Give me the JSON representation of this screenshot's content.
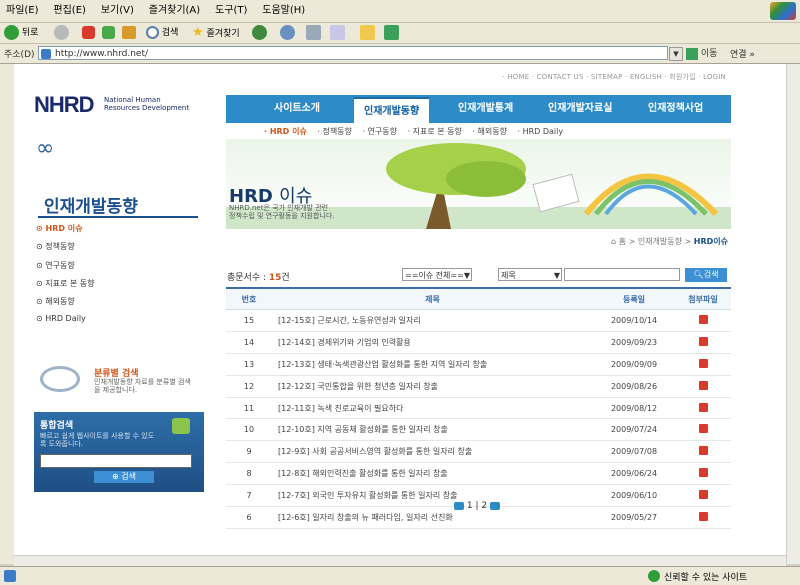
{
  "browser": {
    "menu": [
      "파일(E)",
      "편집(E)",
      "보기(V)",
      "즐겨찾기(A)",
      "도구(T)",
      "도움말(H)"
    ],
    "toolbar": {
      "back": "뒤로",
      "search": "검색",
      "favorites": "즐겨찾기"
    },
    "address_label": "주소(D)",
    "url": "http://www.nhrd.net/",
    "go_label": "이동",
    "links_label": "연결 »",
    "status_text": "신뢰할 수 있는 사이트"
  },
  "site": {
    "util_links": "· HOME · CONTACT US · SITEMAP · ENGLISH · 회원가입 · LOGIN",
    "logo": "NHRD",
    "logo_sub_1": "National Human",
    "logo_sub_2": "Resources Development",
    "gnb": [
      "사이트소개",
      "인재개발동향",
      "인재개발통계",
      "인재개발자료실",
      "인재정책사업"
    ],
    "subnav": [
      "· HRD 이슈",
      "· 정책동향",
      "· 연구동향",
      "· 지표로 본 동향",
      "· 해외동향",
      "· HRD Daily"
    ],
    "side_title": "인재개발동향",
    "side_nav": [
      "HRD 이슈",
      "정책동향",
      "연구동향",
      "지표로 본 동향",
      "해외동향",
      "HRD Daily"
    ],
    "cat_search_title": "분류별 검색",
    "cat_search_desc": "인재개발동향 자료를 분류별 검색을 제공합니다.",
    "total_search_title": "통합검색",
    "total_search_desc": "빠르고 쉽게 웹사이트를 사용할 수 있도록 도와줍니다.",
    "total_search_button": "검색",
    "banner_title_a": "HRD ",
    "banner_title_b": "이슈",
    "banner_desc_1": "NHRD.net은 국가 인재개발 관련",
    "banner_desc_2": "정책수립 및 연구활동을 지원합니다.",
    "crumb": "홈 > 인재개발동향 > ",
    "crumb_current": "HRD이슈"
  },
  "board": {
    "count_label": "총문서수 : ",
    "count_value": "15",
    "count_unit": "건",
    "filter": "==이슈 전체==",
    "field": "제목",
    "search_button": "검색",
    "headers": [
      "번호",
      "제목",
      "등록일",
      "첨부파일"
    ],
    "rows": [
      {
        "no": "15",
        "title": "[12-15호] 근로시간, 노동유연성과 일자리",
        "date": "2009/10/14"
      },
      {
        "no": "14",
        "title": "[12-14호] 경제위기와 기업의 인력활용",
        "date": "2009/09/23"
      },
      {
        "no": "13",
        "title": "[12-13호] 생태·녹색관광산업 활성화를 통한 지역 일자리 창출",
        "date": "2009/09/09"
      },
      {
        "no": "12",
        "title": "[12-12호] 국민통합을 위한 청년층 일자리 창출",
        "date": "2009/08/26"
      },
      {
        "no": "11",
        "title": "[12-11호] 녹색 진로교육이 필요하다",
        "date": "2009/08/12"
      },
      {
        "no": "10",
        "title": "[12-10호] 지역 공동체 활성화를 통한 일자리 창출",
        "date": "2009/07/24"
      },
      {
        "no": "9",
        "title": "[12-9호] 사회 공공서비스영역 활성화를 통한 일자리 창출",
        "date": "2009/07/08"
      },
      {
        "no": "8",
        "title": "[12-8호] 해외인력진출 활성화를 통한 일자리 창출",
        "date": "2009/06/24"
      },
      {
        "no": "7",
        "title": "[12-7호] 외국인 투자유치 활성화를 통한 일자리 창출",
        "date": "2009/06/10"
      },
      {
        "no": "6",
        "title": "[12-6호] 일자리 창출의 뉴 패러다임, 일자리 선진화",
        "date": "2009/05/27"
      }
    ],
    "pages": "1 | 2"
  }
}
